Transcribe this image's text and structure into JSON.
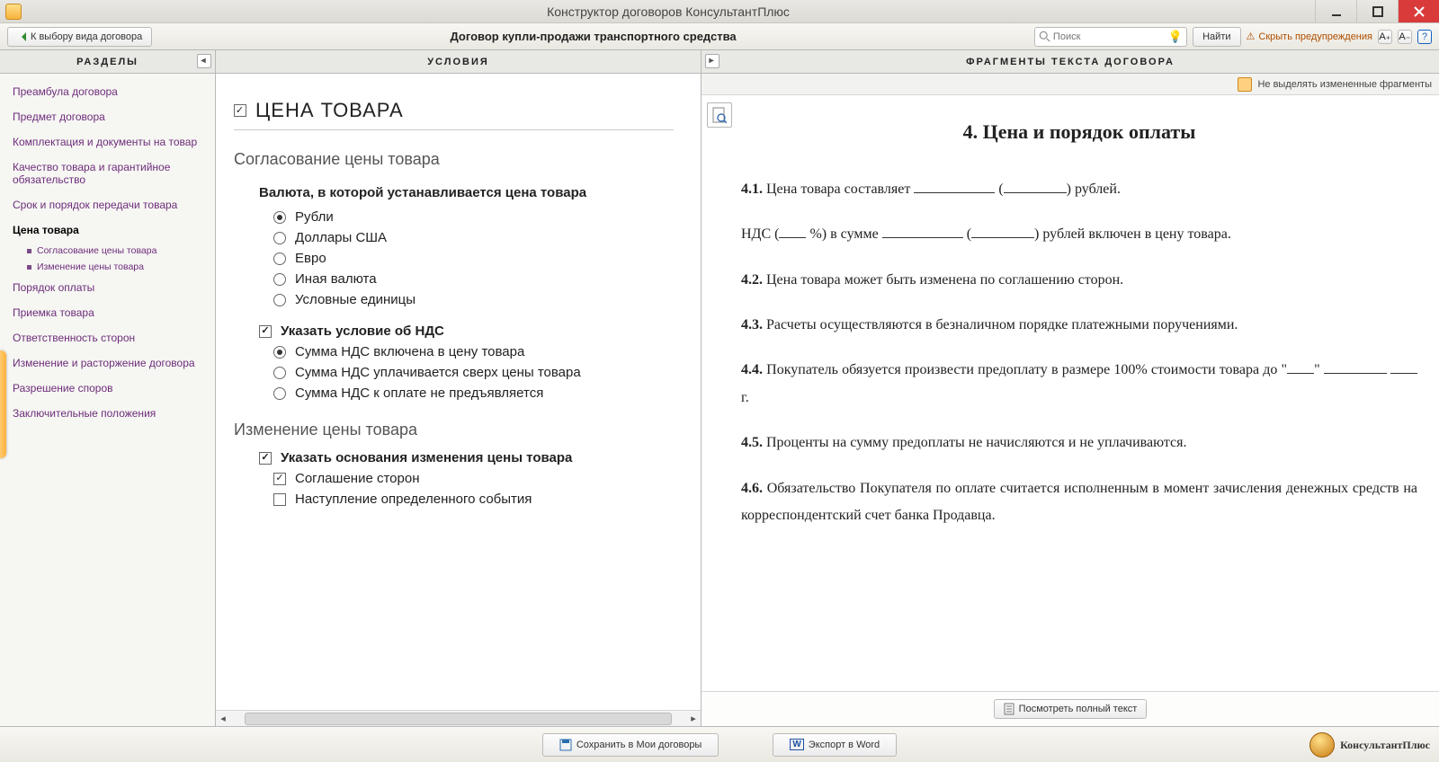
{
  "window": {
    "title": "Конструктор договоров КонсультантПлюс"
  },
  "toolbar": {
    "back_label": "К выбору вида договора",
    "contract_title": "Договор купли-продажи транспортного средства",
    "search_placeholder": "Поиск",
    "find_label": "Найти",
    "hide_warn_label": "Скрыть предупреждения",
    "font_plus": "A₊",
    "font_minus": "A₋",
    "help": "?"
  },
  "panels": {
    "sections": "РАЗДЕЛЫ",
    "conditions": "УСЛОВИЯ",
    "fragments": "ФРАГМЕНТЫ ТЕКСТА ДОГОВОРА"
  },
  "sidebar": {
    "items": [
      {
        "label": "Преамбула договора"
      },
      {
        "label": "Предмет договора"
      },
      {
        "label": "Комплектация и документы на товар"
      },
      {
        "label": "Качество товара и гарантийное обязательство"
      },
      {
        "label": "Срок и порядок передачи товара"
      },
      {
        "label": "Цена товара",
        "current": true,
        "subs": [
          {
            "label": "Согласование цены товара"
          },
          {
            "label": "Изменение цены товара"
          }
        ]
      },
      {
        "label": "Порядок оплаты"
      },
      {
        "label": "Приемка товара"
      },
      {
        "label": "Ответственность сторон"
      },
      {
        "label": "Изменение и расторжение договора"
      },
      {
        "label": "Разрешение споров"
      },
      {
        "label": "Заключительные положения"
      }
    ]
  },
  "conditions": {
    "heading": "ЦЕНА ТОВАРА",
    "section_price_agree": "Согласование цены товара",
    "currency_q": "Валюта, в которой устанавливается цена товара",
    "currency_opts": {
      "rub": "Рубли",
      "usd": "Доллары США",
      "eur": "Евро",
      "other": "Иная валюта",
      "units": "Условные единицы"
    },
    "vat_check": "Указать условие об НДС",
    "vat_opts": {
      "included": "Сумма НДС включена в цену товара",
      "extra": "Сумма НДС уплачивается сверх цены товара",
      "none": "Сумма НДС к оплате не предъявляется"
    },
    "section_price_change": "Изменение цены товара",
    "change_basis_check": "Указать основания изменения цены товара",
    "change_opts": {
      "agreement": "Соглашение сторон",
      "event": "Наступление определенного события"
    }
  },
  "fragments": {
    "no_highlight": "Не выделять измененные фрагменты",
    "view_full": "Посмотреть полный текст",
    "title": "4. Цена и порядок оплаты",
    "c41_n": "4.1.",
    "c41_a": " Цена товара составляет ",
    "c41_b": " (",
    "c41_c": ") рублей.",
    "c_nds_a": "НДС (",
    "c_nds_b": " %) в сумме ",
    "c_nds_c": " (",
    "c_nds_d": ") рублей включен в цену товара.",
    "c42_n": "4.2.",
    "c42": " Цена товара может быть изменена по соглашению сторон.",
    "c43_n": "4.3.",
    "c43": " Расчеты осуществляются в безналичном порядке платежными поручениями.",
    "c44_n": "4.4.",
    "c44_a": " Покупатель обязуется произвести предоплату в размере 100% стоимости товара до \"",
    "c44_b": "\" ",
    "c44_c": " ",
    "c44_d": " г.",
    "c45_n": "4.5.",
    "c45": " Проценты на сумму предоплаты не начисляются и не уплачиваются.",
    "c46_n": "4.6.",
    "c46": " Обязательство Покупателя по оплате считается исполненным в момент зачисления денежных средств на корреспондентский счет банка Продавца."
  },
  "bottom": {
    "save": "Сохранить в Мои договоры",
    "export": "Экспорт в Word",
    "brand": "КонсультантПлюс"
  }
}
